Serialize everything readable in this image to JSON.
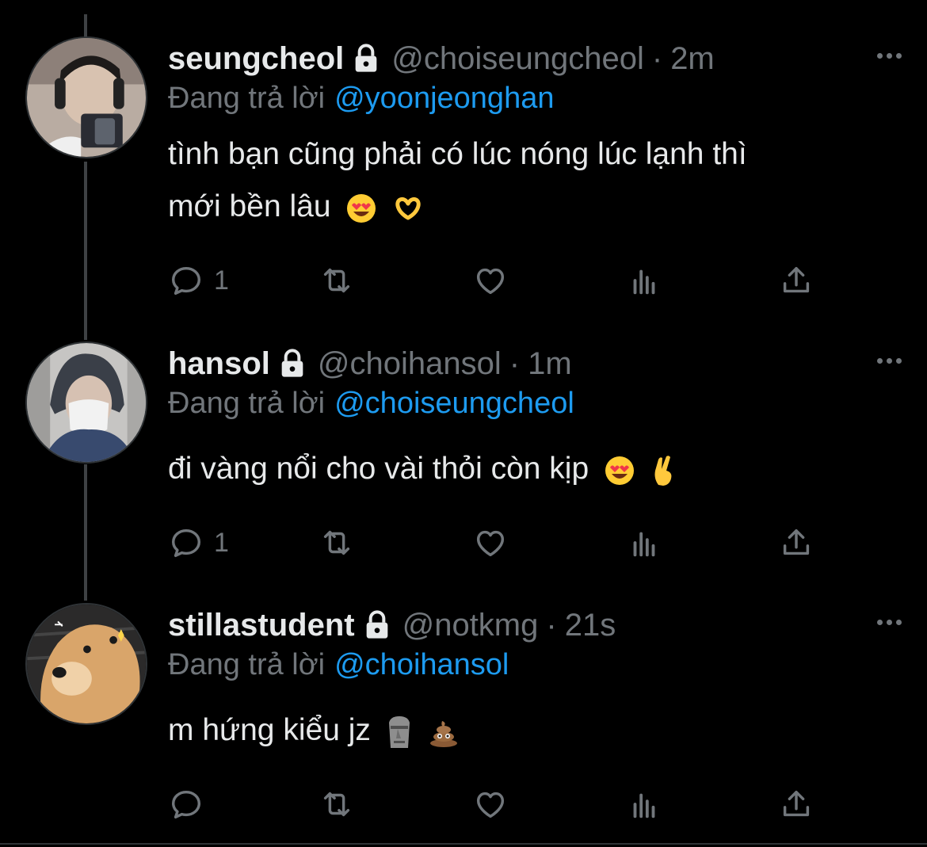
{
  "tweets": [
    {
      "name": "seungcheol",
      "handle": "@choiseungcheol",
      "separator": "·",
      "time": "2m",
      "reply_prefix": "Đang trả lời",
      "reply_to": "@yoonjeonghan",
      "text_line1": "tình bạn cũng phải có lúc nóng lúc lạnh thì",
      "text_line2": "mới bền lâu",
      "emojis": [
        "heart-eyes-emoji",
        "heart-hands-emoji"
      ],
      "reply_count": "1"
    },
    {
      "name": "hansol",
      "handle": "@choihansol",
      "separator": "·",
      "time": "1m",
      "reply_prefix": "Đang trả lời",
      "reply_to": "@choiseungcheol",
      "text_line1": "đi vàng nổi cho vài thỏi còn kịp",
      "emojis": [
        "heart-eyes-emoji",
        "crossed-fingers-emoji"
      ],
      "reply_count": "1"
    },
    {
      "name": "stillastudent",
      "handle": "@notkmg",
      "separator": "·",
      "time": "21s",
      "reply_prefix": "Đang trả lời",
      "reply_to": "@choihansol",
      "text_line1": "m hứng kiểu jz",
      "emojis": [
        "moai-emoji",
        "poop-emoji"
      ],
      "reply_count": ""
    }
  ],
  "icons": {
    "verified_lock": "lock-icon",
    "more": "more-icon",
    "reply": "reply-icon",
    "retweet": "retweet-icon",
    "like": "like-icon",
    "views": "views-icon",
    "share": "share-icon"
  },
  "colors": {
    "background": "#000000",
    "text": "#e7e9ea",
    "muted": "#71767b",
    "link": "#1d9bf0",
    "border": "#2f3336"
  }
}
